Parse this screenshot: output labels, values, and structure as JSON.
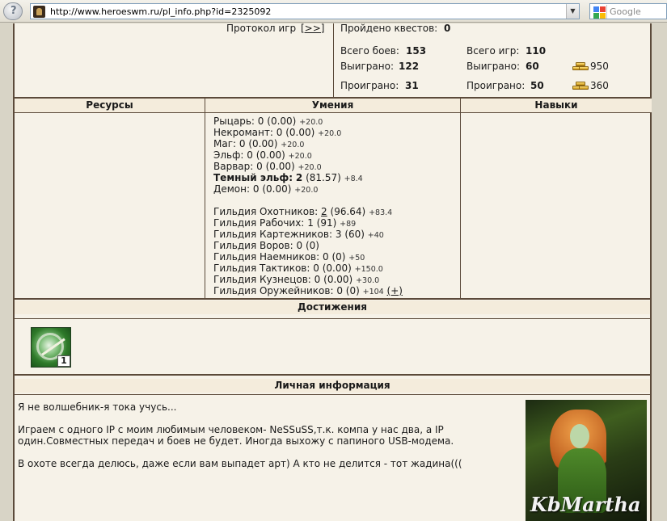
{
  "browser": {
    "url": "http://www.heroeswm.ru/pl_info.php?id=2325092",
    "search_placeholder": "Google"
  },
  "stats": {
    "protocol_label": "Протокол игр",
    "protocol_link": "[>>]",
    "quests_label": "Пройдено квестов:",
    "quests_value": "0",
    "battles_label": "Всего боев:",
    "battles_value": "153",
    "battles_won_label": "Выиграно:",
    "battles_won_value": "122",
    "battles_lost_label": "Проиграно:",
    "battles_lost_value": "31",
    "games_label": "Всего игр:",
    "games_value": "110",
    "games_won_label": "Выиграно:",
    "games_won_value": "60",
    "games_lost_label": "Проиграно:",
    "games_lost_value": "50",
    "gold_won": "950",
    "gold_lost": "360"
  },
  "headers": {
    "resources": "Ресурсы",
    "abilities": "Умения",
    "skills": "Навыки",
    "achievements": "Достижения",
    "personal_info": "Личная информация"
  },
  "abilities": [
    {
      "name": "Рыцарь:",
      "level": "0",
      "value": "(0.00)",
      "bonus": "+20.0"
    },
    {
      "name": "Некромант:",
      "level": "0",
      "value": "(0.00)",
      "bonus": "+20.0"
    },
    {
      "name": "Маг:",
      "level": "0",
      "value": "(0.00)",
      "bonus": "+20.0"
    },
    {
      "name": "Эльф:",
      "level": "0",
      "value": "(0.00)",
      "bonus": "+20.0"
    },
    {
      "name": "Варвар:",
      "level": "0",
      "value": "(0.00)",
      "bonus": "+20.0"
    },
    {
      "name": "Темный эльф:",
      "level": "2",
      "value": "(81.57)",
      "bonus": "+8.4"
    },
    {
      "name": "Демон:",
      "level": "0",
      "value": "(0.00)",
      "bonus": "+20.0"
    }
  ],
  "guilds": [
    {
      "name": "Гильдия Охотников:",
      "level": "2",
      "value": "(96.64)",
      "bonus": "+83.4"
    },
    {
      "name": "Гильдия Рабочих:",
      "level": "1",
      "value": "(91)",
      "bonus": "+89"
    },
    {
      "name": "Гильдия Картежников:",
      "level": "3",
      "value": "(60)",
      "bonus": "+40"
    },
    {
      "name": "Гильдия Воров:",
      "level": "0",
      "value": "(0)",
      "bonus": ""
    },
    {
      "name": "Гильдия Наемников:",
      "level": "0",
      "value": "(0)",
      "bonus": "+50"
    },
    {
      "name": "Гильдия Тактиков:",
      "level": "0",
      "value": "(0.00)",
      "bonus": "+150.0"
    },
    {
      "name": "Гильдия Кузнецов:",
      "level": "0",
      "value": "(0.00)",
      "bonus": "+30.0"
    },
    {
      "name": "Гильдия Оружейников:",
      "level": "0",
      "value": "(0)",
      "bonus": "+104",
      "extra": "(+)"
    }
  ],
  "achievement": {
    "icon": "hunter-achievement-icon",
    "count": "1"
  },
  "personal": {
    "line1": "Я не волшебник-я тока учусь...",
    "line2": "Играем с одного IP с моим любимым человеком- NeSSuSS,т.к. компа у нас два, а IP",
    "line3": "один.Совместных передач и боев не будет. Иногда выхожу с папиного USB-модема.",
    "line4": "В охоте всегда делюсь, даже если вам выпадет арт) А кто не делится - тот жадина(((",
    "signature": "KbMartha"
  }
}
